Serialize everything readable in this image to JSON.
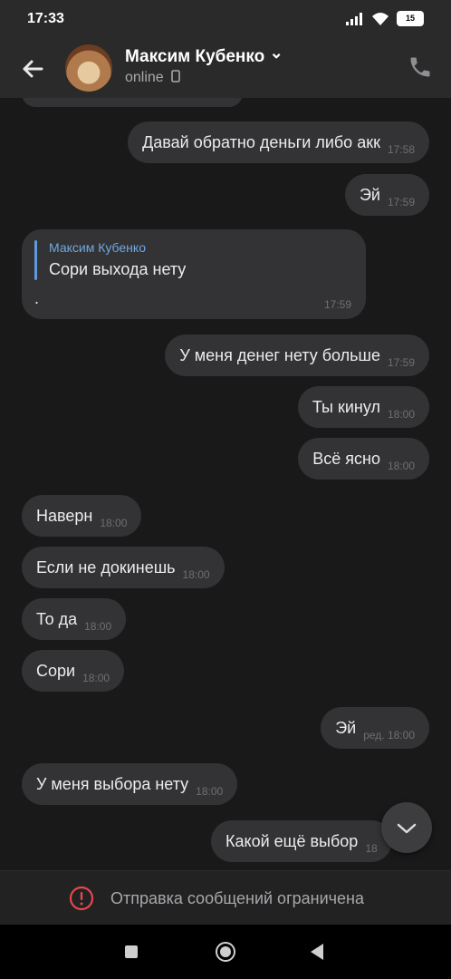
{
  "status_bar": {
    "time": "17:33",
    "battery": "15"
  },
  "header": {
    "name": "Максим Кубенко",
    "status": "online",
    "name_chevron": "⌄"
  },
  "messages": [
    {
      "text": "Давай обратно деньги либо акк",
      "time": "17:58"
    },
    {
      "text": "Эй",
      "time": "17:59"
    },
    {
      "reply_author": "Максим Кубенко",
      "reply_text": "Сори выхода нету",
      "text": ".",
      "time": "17:59"
    },
    {
      "text": "У меня денег нету больше",
      "time": "17:59"
    },
    {
      "text": "Ты кинул",
      "time": "18:00"
    },
    {
      "text": "Всё ясно",
      "time": "18:00"
    },
    {
      "text": "Наверн",
      "time": "18:00"
    },
    {
      "text": "Если не докинешь",
      "time": "18:00"
    },
    {
      "text": "То да",
      "time": "18:00"
    },
    {
      "text": "Сори",
      "time": "18:00"
    },
    {
      "text": "Эй",
      "time": "ред. 18:00"
    },
    {
      "text": "У меня выбора нету",
      "time": "18:00"
    },
    {
      "text": "Какой ещё выбор",
      "time": "18"
    }
  ],
  "footer": {
    "restriction": "Отправка сообщений ограничена"
  },
  "colors": {
    "background": "#19191a",
    "bubble": "#333335",
    "accent": "#5d9bdc",
    "warning": "#e5484d"
  }
}
